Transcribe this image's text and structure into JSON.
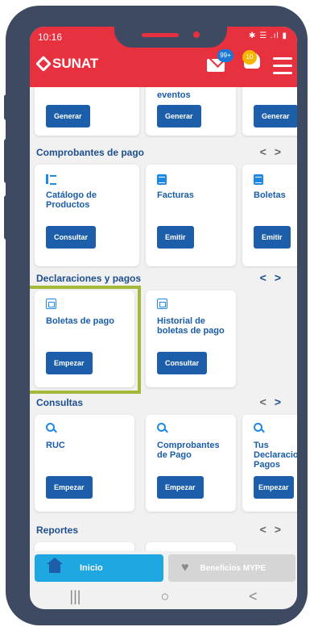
{
  "status": {
    "time": "10:16",
    "icons_right": "✱ ☰ .ıl ▮"
  },
  "header": {
    "brand": "SUNAT",
    "mail_badge": "99+",
    "bell_badge": "10"
  },
  "top_row": {
    "partial_title": "eventos",
    "buttons": [
      "Generar",
      "Generar",
      "Generar"
    ]
  },
  "comprobantes": {
    "title": "Comprobantes de pago",
    "cards": [
      {
        "title": "Catálogo de Productos",
        "button": "Consultar"
      },
      {
        "title": "Facturas",
        "button": "Emitir"
      },
      {
        "title": "Boletas",
        "button": "Emitir"
      }
    ]
  },
  "declaraciones": {
    "title": "Declaraciones y pagos",
    "cards": [
      {
        "title": "Boletas de pago",
        "button": "Empezar"
      },
      {
        "title": "Historial de boletas de pago",
        "button": "Consultar"
      }
    ]
  },
  "consultas": {
    "title": "Consultas",
    "cards": [
      {
        "title": "RUC",
        "button": "Empezar"
      },
      {
        "title": "Comprobantes de Pago",
        "button": "Empezar"
      },
      {
        "title": "Tus Declaraciones Pagos",
        "button": "Empezar"
      }
    ]
  },
  "reportes": {
    "title": "Reportes"
  },
  "arrows": {
    "left": "<",
    "right": ">"
  },
  "bottom_nav": {
    "inicio": "Inicio",
    "beneficios": "Beneficios MYPE"
  },
  "system_nav": {
    "recent": "|||",
    "home": "○",
    "back": "<"
  },
  "colors": {
    "brand_red": "#e8313e",
    "primary_blue": "#1c5ea9",
    "accent_green": "#a3b93a",
    "inicio_blue": "#1ea7e1"
  }
}
